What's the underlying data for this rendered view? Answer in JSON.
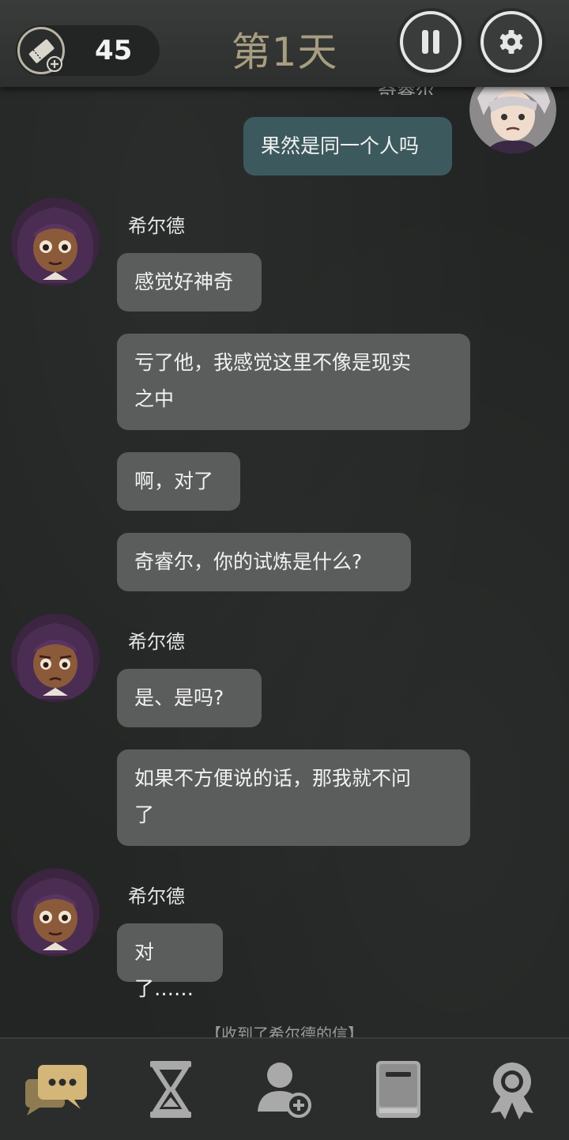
{
  "header": {
    "tickets": "45",
    "day_title": "第1天"
  },
  "top_clipped_name": "奇睿尔",
  "messages": [
    {
      "from": "me",
      "text": "果然是同一个人吗"
    },
    {
      "sender": "希尔德",
      "text": "感觉好神奇"
    },
    {
      "text_line1": "亏了他，我感觉这里不像是现实",
      "text_line2": "之中"
    },
    {
      "text": "啊，对了"
    },
    {
      "text": "奇睿尔，你的试炼是什么?"
    },
    {
      "sender": "希尔德",
      "text": "是、是吗?"
    },
    {
      "text_line1": "如果不方便说的话，那我就不问",
      "text_line2": "了"
    },
    {
      "sender": "希尔德",
      "text": "对了……"
    }
  ],
  "notice": "【收到了希尔德的信】",
  "nav": [
    "chat-icon",
    "hourglass-icon",
    "add-contact-icon",
    "book-icon",
    "achievement-icon"
  ],
  "colors": {
    "accent": "#c7a869",
    "bubble_other": "#5b5c5c",
    "bubble_me": "#3c5a5d",
    "title": "#a79d80"
  }
}
